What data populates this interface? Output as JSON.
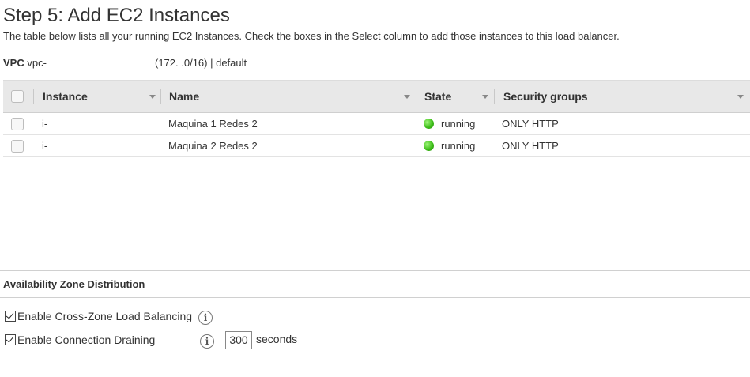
{
  "header": {
    "title": "Step 5: Add EC2 Instances",
    "description": "The table below lists all your running EC2 Instances. Check the boxes in the Select column to add those instances to this load balancer."
  },
  "vpc": {
    "label": "VPC",
    "id": "vpc-",
    "cidr": "(172.       .0/16) | default"
  },
  "table": {
    "columns": [
      "Instance",
      "Name",
      "State",
      "Security groups"
    ],
    "rows": [
      {
        "instance": "i-",
        "name": "Maquina 1 Redes 2",
        "state": "running",
        "security_groups": "ONLY HTTP",
        "selected": false
      },
      {
        "instance": "i-",
        "name": "Maquina 2 Redes 2",
        "state": "running",
        "security_groups": "ONLY HTTP",
        "selected": false
      }
    ]
  },
  "availability": {
    "title": "Availability Zone Distribution",
    "cross_zone_label": "Enable Cross-Zone Load Balancing",
    "cross_zone_checked": true,
    "draining_label": "Enable Connection Draining",
    "draining_checked": true,
    "draining_timeout": "300",
    "seconds_label": "seconds"
  },
  "icons": {
    "info": "info-icon",
    "sort": "chevron-down-icon",
    "status": "green-status-dot-icon"
  },
  "colors": {
    "running": "#3fbf1a",
    "header_bg": "#e8e8e8"
  }
}
